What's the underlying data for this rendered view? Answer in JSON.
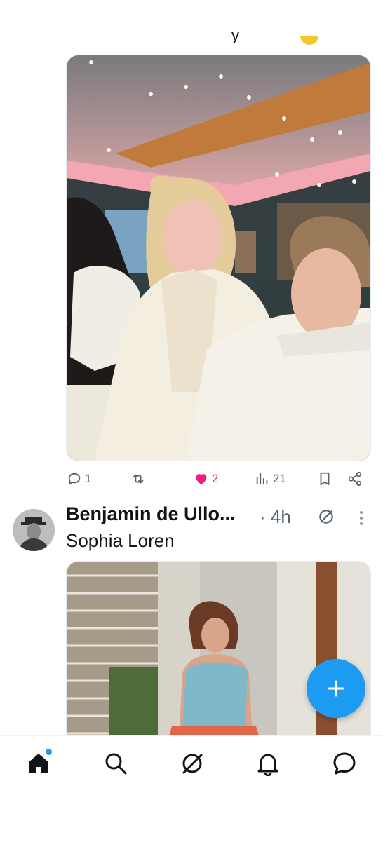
{
  "tweet1": {
    "actions": {
      "reply_count": "1",
      "retweet_count": "",
      "like_count": "2",
      "view_count": "21"
    }
  },
  "tweet2": {
    "author_name": "Benjamin de Ullo...",
    "separator": "·",
    "time": "4h",
    "text": "Sophia Loren"
  },
  "fab": {
    "icon": "plus-icon"
  },
  "bottom_nav": {
    "items": [
      {
        "name": "home",
        "icon": "home-icon",
        "active": true,
        "notification_dot": true
      },
      {
        "name": "search",
        "icon": "search-icon"
      },
      {
        "name": "grok",
        "icon": "grok-icon"
      },
      {
        "name": "notifications",
        "icon": "bell-icon"
      },
      {
        "name": "messages",
        "icon": "message-icon"
      }
    ]
  },
  "colors": {
    "accent": "#1d9bf0",
    "like": "#f91880",
    "text": "#0f1419",
    "muted": "#536471"
  }
}
